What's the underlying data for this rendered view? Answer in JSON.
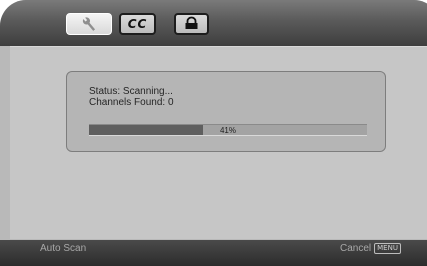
{
  "tabs": [
    {
      "icon": "wrench-icon",
      "label": ""
    },
    {
      "icon": "cc-icon",
      "label": "CC"
    },
    {
      "icon": "lock-icon",
      "label": ""
    }
  ],
  "scan": {
    "status": "Status: Scanning...",
    "channels_found": "Channels Found: 0",
    "progress_percent": 41,
    "progress_label": "41%"
  },
  "footer": {
    "title": "Auto Scan",
    "cancel_label": "Cancel",
    "menu_key_label": "MENU"
  },
  "colors": {
    "frame": "#b9b9b9",
    "topbar": "#4f4f4f",
    "progress_fill": "#5f5f5f"
  }
}
